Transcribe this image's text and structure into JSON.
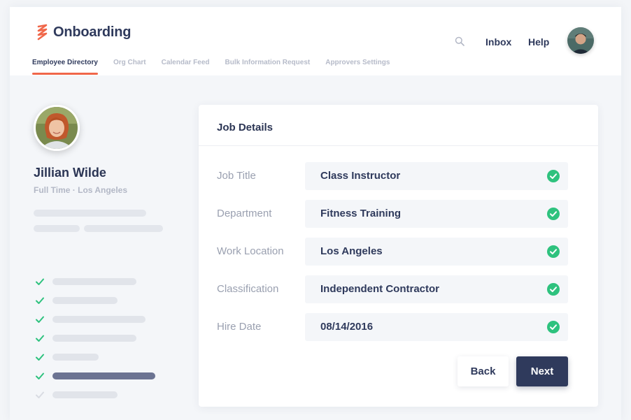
{
  "app": {
    "title": "Onboarding",
    "brand_color": "#f0674a"
  },
  "header": {
    "tabs": [
      {
        "label": "Employee Directory",
        "active": true
      },
      {
        "label": "Org Chart",
        "active": false
      },
      {
        "label": "Calendar Feed",
        "active": false
      },
      {
        "label": "Bulk Information Request",
        "active": false
      },
      {
        "label": "Approvers Settings",
        "active": false
      }
    ],
    "search_icon": "search-icon",
    "inbox_label": "Inbox",
    "help_label": "Help",
    "user_avatar_icon": "avatar"
  },
  "profile": {
    "name": "Jillian Wilde",
    "meta": "Full Time · Los Angeles",
    "checklist_completed_count": 6,
    "checklist_total_count": 7
  },
  "card": {
    "title": "Job Details",
    "fields": [
      {
        "label": "Job Title",
        "value": "Class Instructor",
        "valid": true
      },
      {
        "label": "Department",
        "value": "Fitness Training",
        "valid": true
      },
      {
        "label": "Work Location",
        "value": "Los Angeles",
        "valid": true
      },
      {
        "label": "Classification",
        "value": "Independent Contractor",
        "valid": true
      },
      {
        "label": "Hire Date",
        "value": "08/14/2016",
        "valid": true
      }
    ],
    "back_label": "Back",
    "next_label": "Next"
  },
  "colors": {
    "primary": "#2f3a5c",
    "success": "#2ec27e",
    "accent": "#f0674a"
  }
}
